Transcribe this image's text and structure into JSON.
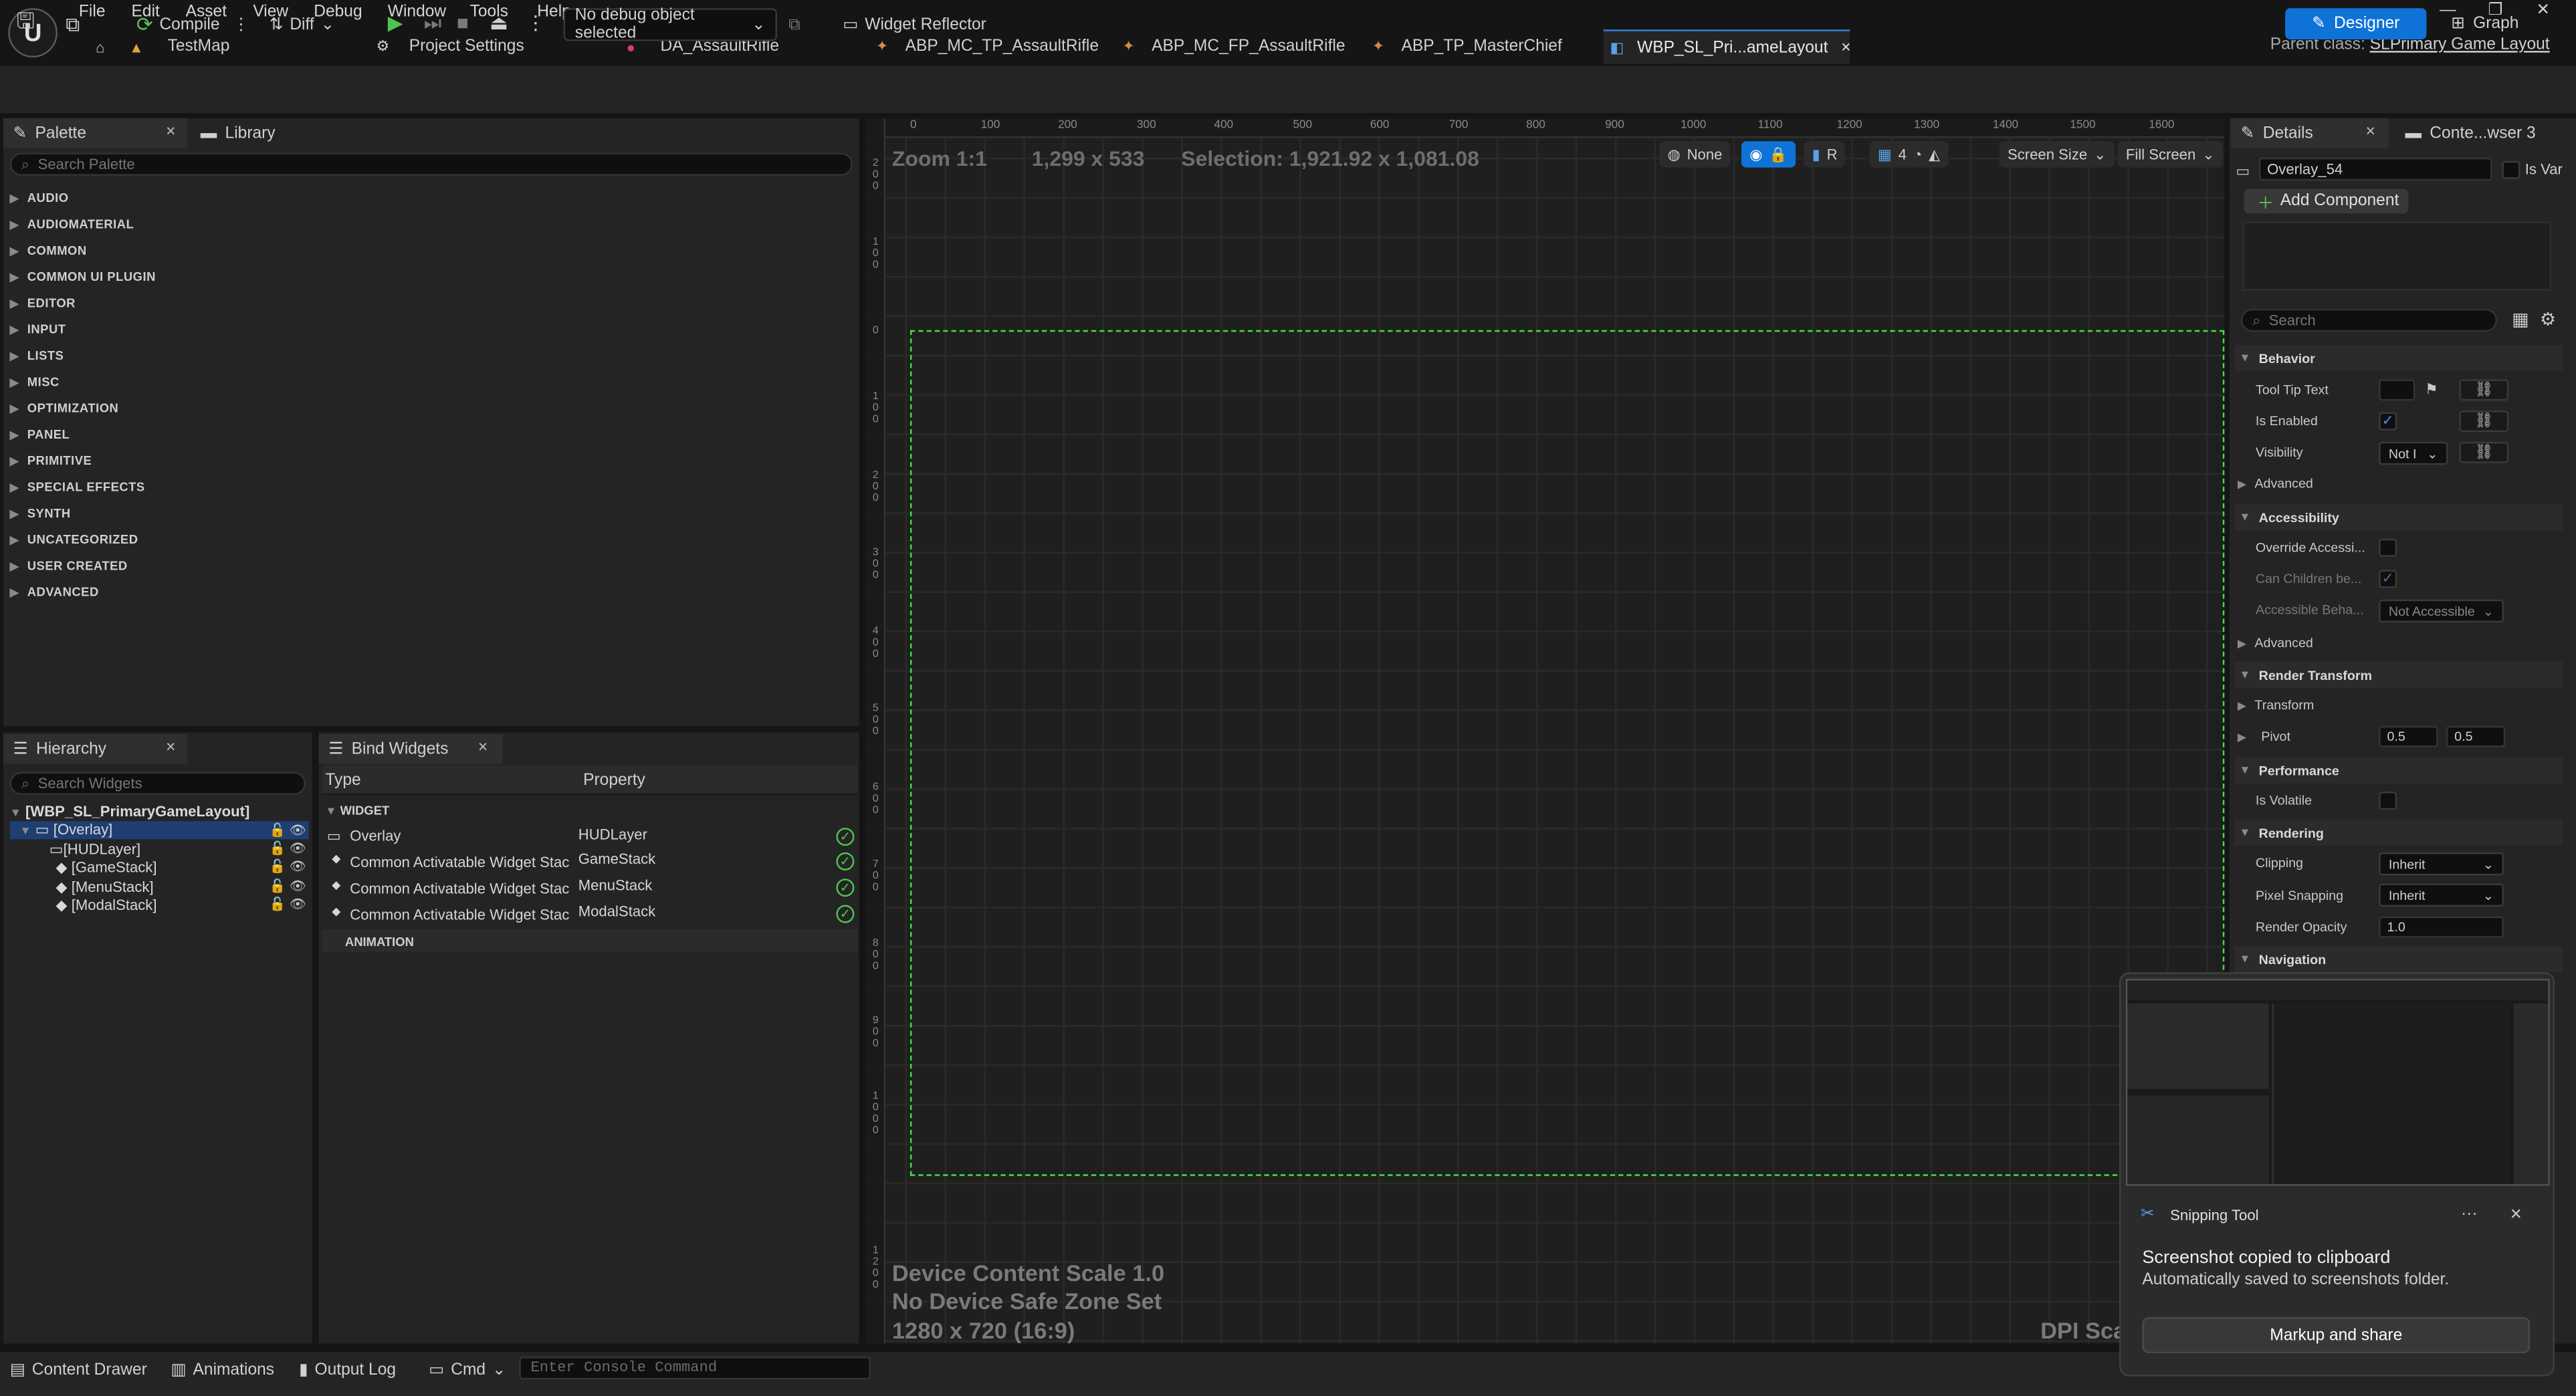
{
  "menu": [
    "File",
    "Edit",
    "Asset",
    "View",
    "Debug",
    "Window",
    "Tools",
    "Help"
  ],
  "tabs": [
    {
      "label": "TestMap"
    },
    {
      "label": "Project Settings"
    },
    {
      "label": "DA_AssaultRifle"
    },
    {
      "label": "ABP_MC_TP_AssaultRifle"
    },
    {
      "label": "ABP_MC_FP_AssaultRifle"
    },
    {
      "label": "ABP_TP_MasterChief"
    },
    {
      "label": "WBP_SL_Pri...ameLayout",
      "close": "×"
    }
  ],
  "parent_class": {
    "prefix": "Parent class:",
    "value": "SLPrimary Game Layout"
  },
  "toolbar": {
    "compile": "Compile",
    "diff": "Diff",
    "debug_select": "No debug object selected",
    "widget_reflector": "Widget Reflector",
    "designer": "Designer",
    "graph": "Graph"
  },
  "palette": {
    "tab": "Palette",
    "library_tab": "Library",
    "search_placeholder": "Search Palette",
    "categories": [
      "AUDIO",
      "AUDIOMATERIAL",
      "COMMON",
      "COMMON UI PLUGIN",
      "EDITOR",
      "INPUT",
      "LISTS",
      "MISC",
      "OPTIMIZATION",
      "PANEL",
      "PRIMITIVE",
      "SPECIAL EFFECTS",
      "SYNTH",
      "UNCATEGORIZED",
      "USER CREATED",
      "ADVANCED"
    ]
  },
  "hierarchy": {
    "tab": "Hierarchy",
    "search_placeholder": "Search Widgets",
    "root": "[WBP_SL_PrimaryGameLayout]",
    "items": [
      "[Overlay]",
      "[HUDLayer]",
      "[GameStack]",
      "[MenuStack]",
      "[ModalStack]"
    ]
  },
  "bind_widgets": {
    "tab": "Bind Widgets",
    "col_type": "Type",
    "col_property": "Property",
    "section_widget": "WIDGET",
    "section_animation": "ANIMATION",
    "rows": [
      {
        "type": "Overlay",
        "property": "HUDLayer"
      },
      {
        "type": "Common Activatable Widget Stac",
        "property": "GameStack"
      },
      {
        "type": "Common Activatable Widget Stac",
        "property": "MenuStack"
      },
      {
        "type": "Common Activatable Widget Stac",
        "property": "ModalStack"
      }
    ]
  },
  "viewport": {
    "zoom": "Zoom 1:1",
    "size": "1,299 x 533",
    "selection": "Selection: 1,921.92 x 1,081.08",
    "none_btn": "None",
    "r_btn": "R",
    "grid_num": "4",
    "screen_size": "Screen Size",
    "fill_screen": "Fill Screen",
    "scale_info": "Device Content Scale 1.0",
    "safe_zone": "No Device Safe Zone Set",
    "resolution": "1280 x 720 (16:9)",
    "dpi": "DPI Sca",
    "ruler_top": [
      "0",
      "100",
      "200",
      "300",
      "400",
      "500",
      "600",
      "700",
      "800",
      "900",
      "1000",
      "1100",
      "1200",
      "1300",
      "1400",
      "1500",
      "1600"
    ]
  },
  "details": {
    "tab": "Details",
    "tab2": "Conte...wser 3",
    "widget_name": "Overlay_54",
    "is_variable": "Is Var",
    "add_component": "Add Component",
    "search_placeholder": "Search",
    "behavior": "Behavior",
    "tooltip_text": "Tool Tip Text",
    "is_enabled": "Is Enabled",
    "visibility": "Visibility",
    "visibility_value": "Not I",
    "advanced": "Advanced",
    "accessibility": "Accessibility",
    "override_access": "Override Accessi...",
    "can_children": "Can Children be...",
    "accessible_beh": "Accessible Beha...",
    "not_accessible": "Not Accessible",
    "render_transform": "Render Transform",
    "transform": "Transform",
    "pivot": "Pivot",
    "pivot_x": "0.5",
    "pivot_y": "0.5",
    "performance": "Performance",
    "is_volatile": "Is Volatile",
    "rendering": "Rendering",
    "clipping": "Clipping",
    "clipping_value": "Inherit",
    "pixel_snapping": "Pixel Snapping",
    "pixel_snapping_value": "Inherit",
    "render_opacity": "Render Opacity",
    "render_opacity_value": "1.0",
    "navigation": "Navigation"
  },
  "statusbar": {
    "content_drawer": "Content Drawer",
    "animations": "Animations",
    "output_log": "Output Log",
    "cmd": "Cmd",
    "console_placeholder": "Enter Console Command"
  },
  "toast": {
    "app": "Snipping Tool",
    "more": "···",
    "close": "×",
    "title": "Screenshot copied to clipboard",
    "subtitle": "Automatically saved to screenshots folder.",
    "button": "Markup and share"
  },
  "colors": {
    "accent": "#0e72d6",
    "canvas_outline": "#3de23d",
    "ok": "#4fc24f"
  }
}
